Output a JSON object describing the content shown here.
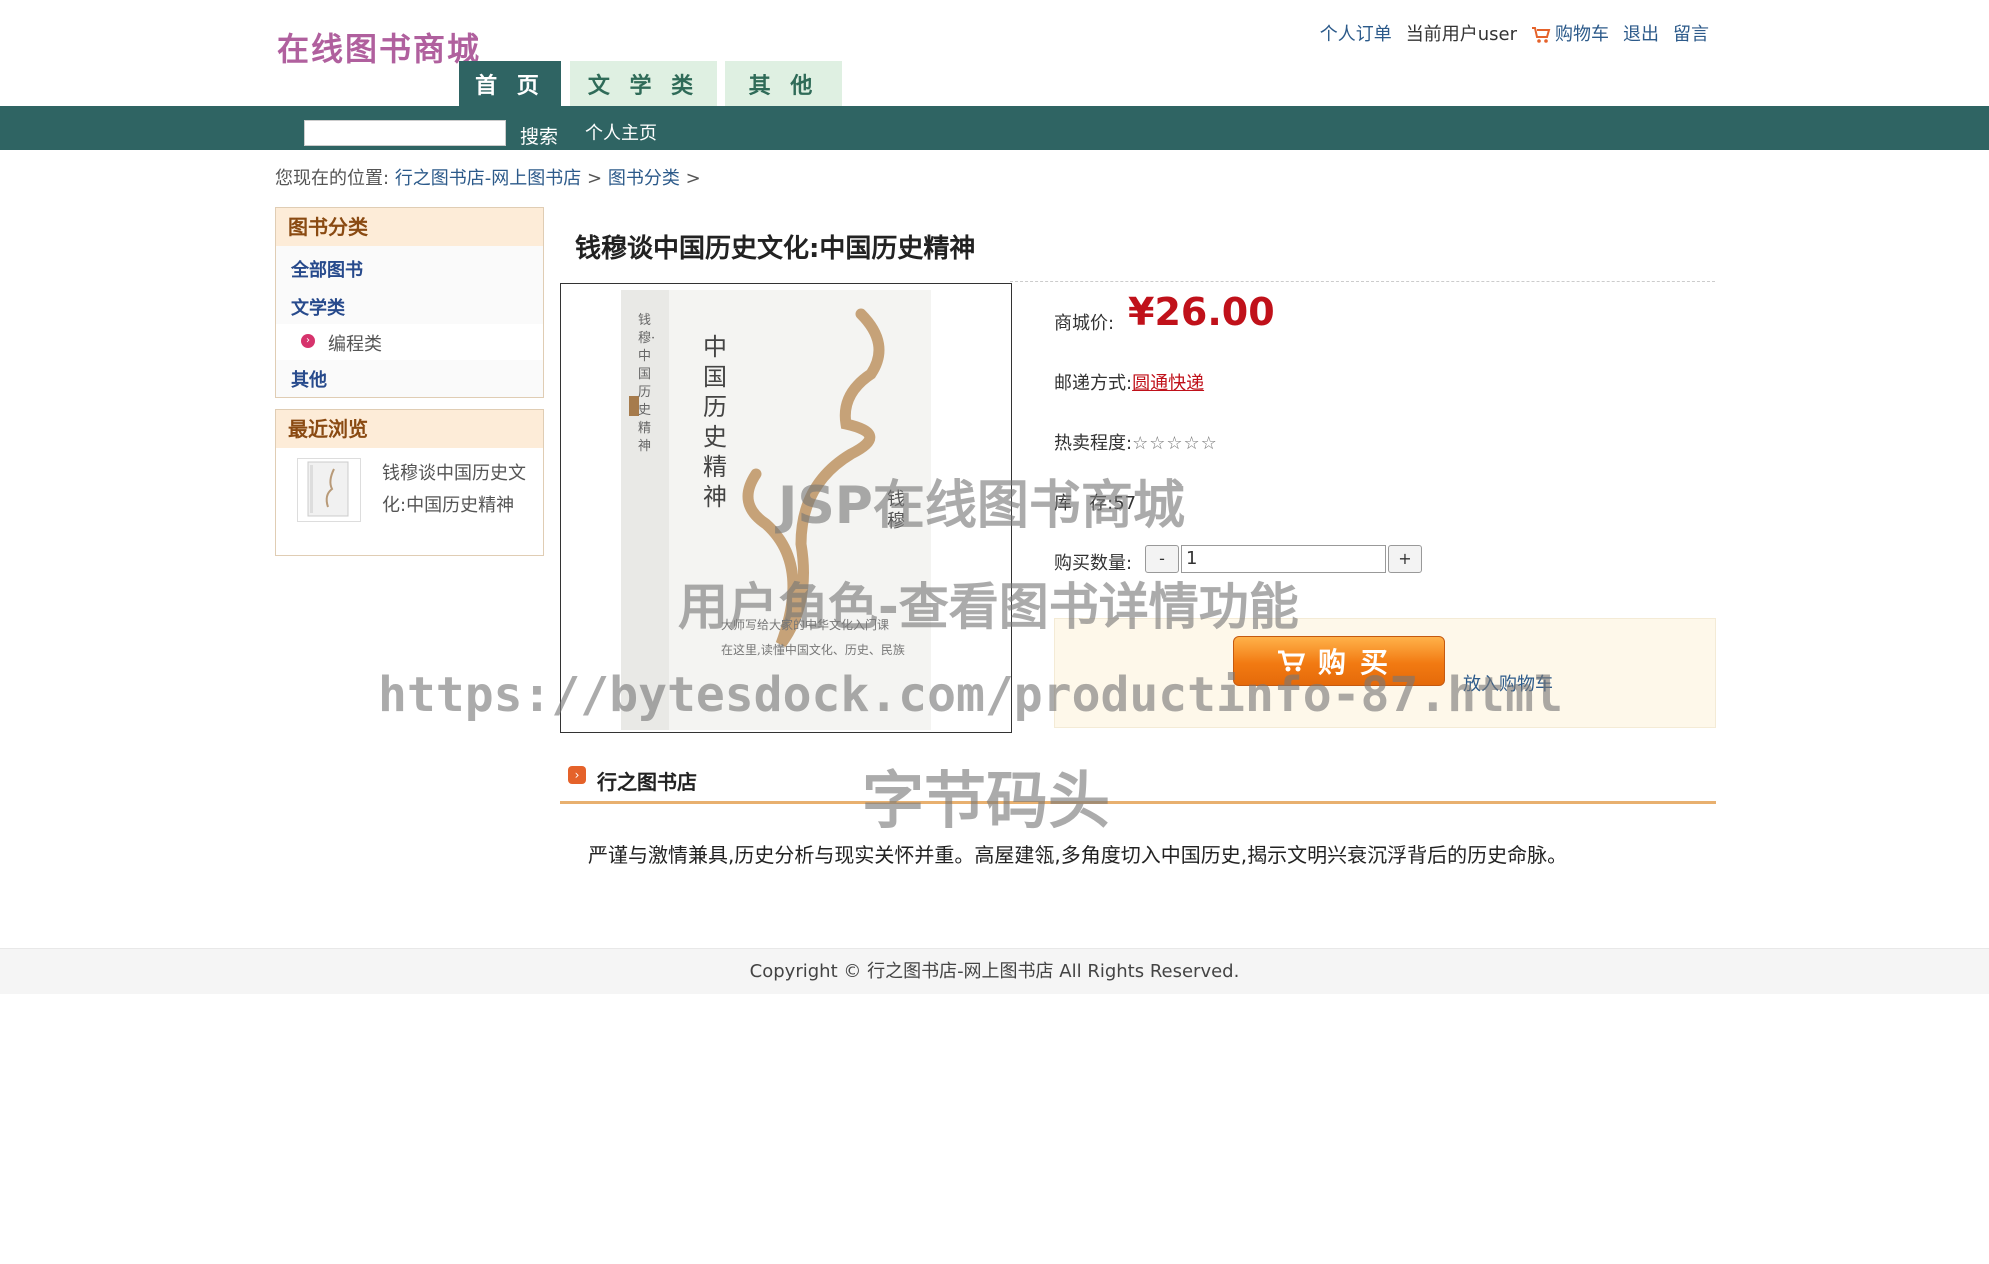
{
  "header": {
    "logo": "在线图书商城",
    "links": {
      "orders": "个人订单",
      "current_user": "当前用户user",
      "cart": "购物车",
      "logout": "退出",
      "message": "留言"
    },
    "tabs": [
      "首 页",
      "文 学 类",
      "其 他"
    ]
  },
  "nav": {
    "search_button": "搜索",
    "home_link": "个人主页"
  },
  "breadcrumb": {
    "prefix": "您现在的位置:",
    "items": [
      "行之图书店-网上图书店",
      "图书分类"
    ],
    "separator": ">"
  },
  "sidebar": {
    "categories_title": "图书分类",
    "categories": [
      "全部图书",
      "文学类",
      "编程类",
      "其他"
    ],
    "recent_title": "最近浏览",
    "recent_item": [
      "钱穆谈中国历史文",
      "化:中国历史精神"
    ]
  },
  "product": {
    "title": "钱穆谈中国历史文化:中国历史精神",
    "price_label": "商城价:",
    "price": "¥26.00",
    "shipping_label": "邮递方式:",
    "shipping": "圆通快递",
    "hot_label": "热卖程度:",
    "stars": "☆☆☆☆☆",
    "stock_label": "库   存:",
    "stock": "57",
    "qty_label": "购买数量:",
    "qty_minus": "-",
    "qty_value": "1",
    "qty_plus": "+",
    "buy_button": "购买",
    "add_to_cart": "放入购物车",
    "cover": {
      "title_chars": "中国历史精神",
      "spine": "钱穆·中国历史精神",
      "author": "钱穆",
      "tagline": "大师写给大家的中华文化入门课",
      "tagline2": "在这里,读懂中国文化、历史、民族"
    }
  },
  "store": {
    "name": "行之图书店",
    "description": "严谨与激情兼具,历史分析与现实关怀并重。高屋建瓴,多角度切入中国历史,揭示文明兴衰沉浮背后的历史命脉。"
  },
  "footer": {
    "copyright": "Copyright © 行之图书店-网上图书店 All Rights Reserved."
  },
  "watermark": {
    "line1": "JSP在线图书商城",
    "line2": "用户角色-查看图书详情功能",
    "line3": "https://bytesdock.com/productinfo-87.html",
    "line4": "字节码头"
  },
  "colors": {
    "nav_bg": "#2f6463",
    "price": "#c0111a",
    "logo": "#b0609e",
    "buy_button": "#f27a12"
  }
}
